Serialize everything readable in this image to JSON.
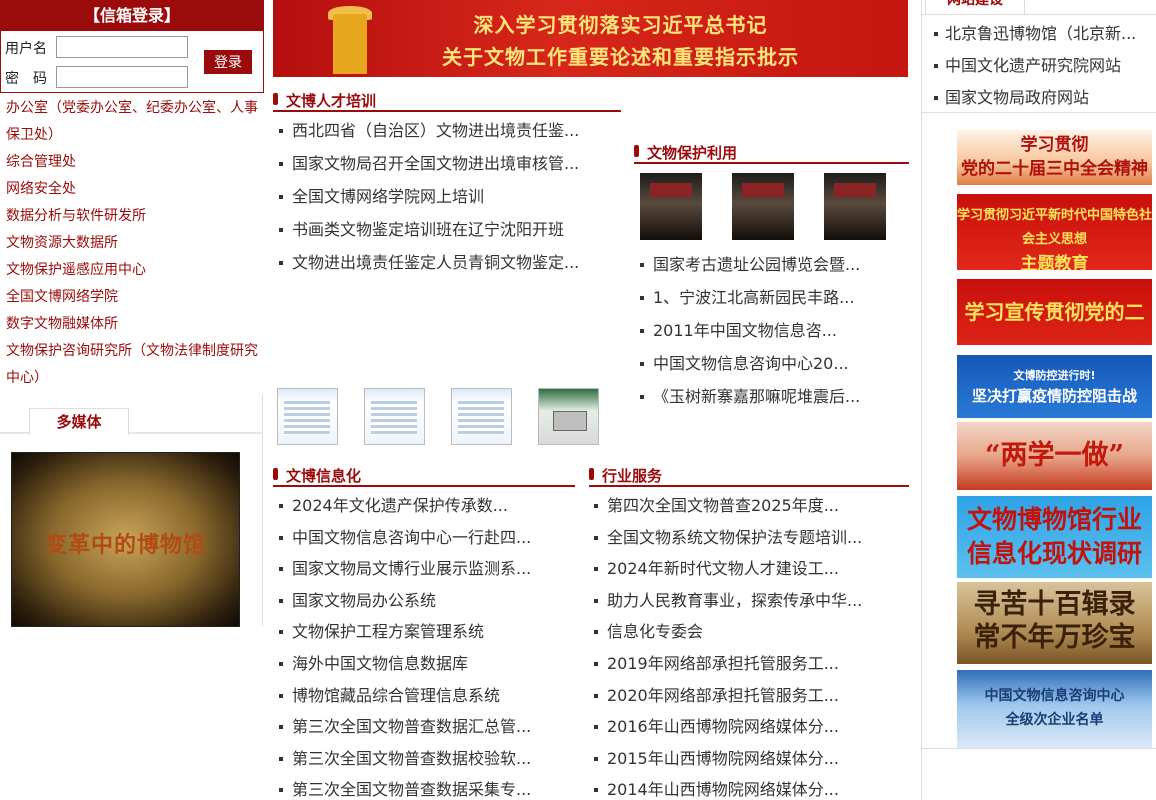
{
  "login": {
    "title": "【信箱登录】",
    "username_label": "用户名",
    "password_label": "密　码",
    "submit_label": "登录"
  },
  "departments": [
    "办公室（党委办公室、纪委办公室、人事保卫处）",
    "综合管理处",
    "网络安全处",
    "数据分析与软件研发所",
    "文物资源大数据所",
    "文物保护遥感应用中心",
    "全国文博网络学院",
    "数字文物融媒体所",
    "文物保护咨询研究所（文物法律制度研究中心）"
  ],
  "multimedia": {
    "tab_label": "多媒体",
    "video_caption": "变革中的博物馆"
  },
  "banner": {
    "line1": "深入学习贯彻落实习近平总书记",
    "line2": "关于文物工作重要论述和重要指示批示"
  },
  "training": {
    "title": "文博人才培训",
    "items": [
      "西北四省（自治区）文物进出境责任鉴...",
      "国家文物局召开全国文物进出境审核管...",
      "全国文博网络学院网上培训",
      "书画类文物鉴定培训班在辽宁沈阳开班",
      "文物进出境责任鉴定人员青铜文物鉴定..."
    ]
  },
  "protection": {
    "title": "文物保护利用",
    "items": [
      "国家考古遗址公园博览会暨...",
      "1、宁波江北高新园民丰路...",
      "2011年中国文物信息咨...",
      "中国文物信息咨询中心20...",
      "《玉树新寨嘉那嘛呢堆震后..."
    ]
  },
  "informatization": {
    "title": "文博信息化",
    "items": [
      "2024年文化遗产保护传承数...",
      "中国文物信息咨询中心一行赴四...",
      "国家文物局文博行业展示监测系...",
      "国家文物局办公系统",
      "文物保护工程方案管理系统",
      "海外中国文物信息数据库",
      "博物馆藏品综合管理信息系统",
      "第三次全国文物普查数据汇总管...",
      "第三次全国文物普查数据校验软...",
      "第三次全国文物普查数据采集专..."
    ]
  },
  "industry": {
    "title": "行业服务",
    "items": [
      "第四次全国文物普查2025年度...",
      "全国文物系统文物保护法专题培训...",
      "2024年新时代文物人才建设工...",
      "助力人民教育事业，探索传承中华...",
      "信息化专委会",
      "2019年网络部承担托管服务工...",
      "2020年网络部承担托管服务工...",
      "2016年山西博物院网络媒体分...",
      "2015年山西博物院网络媒体分...",
      "2014年山西博物院网络媒体分..."
    ]
  },
  "website": {
    "tab_label": "网站建设",
    "links": [
      "北京鲁迅博物馆（北京新...",
      "中国文化遗产研究院网站",
      "国家文物局政府网站"
    ]
  },
  "promos": {
    "p1": [
      "学习贯彻",
      "党的二十届三中全会精神"
    ],
    "p2": [
      "学习贯彻习近平新时代中国特色社会主义思想",
      "主题教育"
    ],
    "p3": "学习宣传贯彻党的二十大精神",
    "p4": [
      "文博防控进行时!",
      "坚决打赢疫情防控阻击战"
    ],
    "p5": "“两学一做”",
    "p6": [
      "文物博物馆行业",
      "信息化现状调研"
    ],
    "p7": [
      "寻苦十百辑录",
      "常不年万珍宝"
    ],
    "p8": [
      "中国文物信息咨询中心",
      "全级次企业名单"
    ]
  },
  "colors": {
    "brand_red": "#9b0b0b",
    "banner_red": "#c4150f",
    "banner_text": "#ffe57a"
  }
}
